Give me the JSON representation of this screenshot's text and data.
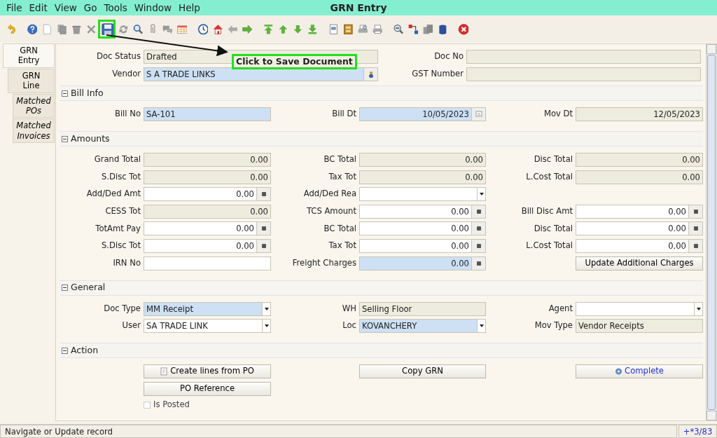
{
  "window": {
    "title": "GRN Entry"
  },
  "menu": [
    {
      "label": "File"
    },
    {
      "label": "Edit"
    },
    {
      "label": "View"
    },
    {
      "label": "Go"
    },
    {
      "label": "Tools"
    },
    {
      "label": "Window"
    },
    {
      "label": "Help"
    }
  ],
  "toolbar": [
    [
      {
        "kind": "undo",
        "highlighted": false
      }
    ],
    [
      {
        "kind": "help",
        "highlighted": false
      },
      {
        "kind": "new",
        "highlighted": false
      },
      {
        "kind": "copy",
        "highlighted": false
      },
      {
        "kind": "delete",
        "highlighted": false
      },
      {
        "kind": "delete-selection",
        "highlighted": false
      },
      {
        "kind": "save",
        "highlighted": true
      },
      {
        "kind": "refresh",
        "highlighted": false
      },
      {
        "kind": "find",
        "highlighted": false
      },
      {
        "kind": "attach",
        "highlighted": false
      },
      {
        "kind": "chat",
        "highlighted": false
      },
      {
        "kind": "grid",
        "highlighted": false
      }
    ],
    [
      {
        "kind": "history",
        "highlighted": false
      },
      {
        "kind": "home",
        "highlighted": false
      },
      {
        "kind": "previous",
        "highlighted": false
      },
      {
        "kind": "next",
        "highlighted": false
      }
    ],
    [
      {
        "kind": "first",
        "highlighted": false
      },
      {
        "kind": "up",
        "highlighted": false
      },
      {
        "kind": "down",
        "highlighted": false
      },
      {
        "kind": "last",
        "highlighted": false
      }
    ],
    [
      {
        "kind": "report",
        "highlighted": false
      },
      {
        "kind": "archive",
        "highlighted": false
      },
      {
        "kind": "print-preview",
        "highlighted": false
      },
      {
        "kind": "print",
        "highlighted": false
      }
    ],
    [
      {
        "kind": "zoom",
        "highlighted": false
      },
      {
        "kind": "move",
        "highlighted": false
      },
      {
        "kind": "product",
        "highlighted": false
      },
      {
        "kind": "workflow",
        "highlighted": false
      }
    ],
    [
      {
        "kind": "exit",
        "highlighted": false
      }
    ]
  ],
  "callout": {
    "text": "Click to Save Document"
  },
  "tabs": [
    {
      "label": "GRN Entry",
      "selected": true,
      "read_only": false,
      "children": [
        {
          "label": "GRN Line",
          "selected": false,
          "read_only": false,
          "children": [
            {
              "label": "Matched POs",
              "selected": false,
              "read_only": true
            },
            {
              "label": "Matched Invoices",
              "selected": false,
              "read_only": true
            }
          ]
        }
      ]
    }
  ],
  "header": [
    {
      "label": "Doc Status",
      "kind": "text",
      "read_only": true,
      "value": "Drafted"
    },
    {
      "label": "Doc No",
      "kind": "text",
      "read_only": true
    },
    {
      "label": "Vendor",
      "kind": "search",
      "value": "S A TRADE LINKS",
      "mandatory": true
    },
    {
      "label": "GST Number",
      "kind": "text",
      "read_only": true
    }
  ],
  "sections": [
    {
      "title": "Bill Info",
      "expanded": true,
      "rows": [
        [
          {
            "label": "Bill No",
            "kind": "text",
            "value": "SA-101",
            "mandatory": true
          },
          {
            "label": "Bill Dt",
            "kind": "date",
            "value": "10/05/2023",
            "mandatory": true
          },
          {
            "label": "Mov Dt",
            "kind": "date",
            "read_only": true,
            "value": "12/05/2023"
          }
        ]
      ]
    },
    {
      "title": "Amounts",
      "expanded": true,
      "rows": [
        [
          {
            "label": "Grand Total",
            "kind": "number",
            "read_only": true,
            "value": "0.00"
          },
          {
            "label": "BC Total",
            "kind": "number",
            "read_only": true,
            "value": "0.00"
          },
          {
            "label": "Disc Total",
            "kind": "number",
            "read_only": true,
            "value": "0.00"
          }
        ],
        [
          {
            "label": "S.Disc Tot",
            "kind": "number",
            "read_only": true,
            "value": "0.00"
          },
          {
            "label": "Tax Tot",
            "kind": "number",
            "read_only": true,
            "value": "0.00"
          },
          {
            "label": "L.Cost Total",
            "kind": "number",
            "read_only": true,
            "value": "0.00"
          }
        ],
        [
          {
            "label": "Add/Ded Amt",
            "kind": "number",
            "value": "0.00"
          },
          {
            "label": "Add/Ded Rea",
            "kind": "select"
          },
          null
        ],
        [
          {
            "label": "CESS Tot",
            "kind": "number",
            "read_only": true,
            "value": "0.00"
          },
          {
            "label": "TCS Amount",
            "kind": "number",
            "value": "0.00"
          },
          {
            "label": "Bill Disc Amt",
            "kind": "number",
            "value": "0.00"
          }
        ],
        [
          {
            "label": "TotAmt Pay",
            "kind": "number",
            "value": "0.00"
          },
          {
            "label": "BC Total",
            "kind": "number",
            "value": "0.00"
          },
          {
            "label": "Disc Total",
            "kind": "number",
            "value": "0.00"
          }
        ],
        [
          {
            "label": "S.Disc Tot",
            "kind": "number",
            "value": "0.00"
          },
          {
            "label": "Tax Tot",
            "kind": "number",
            "value": "0.00"
          },
          {
            "label": "L.Cost Total",
            "kind": "number",
            "value": "0.00"
          }
        ],
        [
          {
            "label": "IRN No",
            "kind": "text"
          },
          {
            "label": "Freight Charges",
            "kind": "number",
            "value": "0.00",
            "mandatory": true
          },
          {
            "kind": "button",
            "text": "Update Additional Charges",
            "highlighted": false
          }
        ]
      ]
    },
    {
      "title": "General",
      "expanded": true,
      "rows": [
        [
          {
            "label": "Doc Type",
            "kind": "select",
            "value": "MM Receipt",
            "mandatory": true
          },
          {
            "label": "WH",
            "kind": "text",
            "read_only": true,
            "value": "Selling Floor"
          },
          {
            "label": "Agent",
            "kind": "select"
          }
        ],
        [
          {
            "label": "User",
            "kind": "select",
            "value": "SA TRADE LINK"
          },
          {
            "label": "Loc",
            "kind": "select",
            "value": "KOVANCHERY",
            "mandatory": true
          },
          {
            "label": "Mov Type",
            "kind": "text",
            "read_only": true,
            "value": "Vendor Receipts"
          }
        ]
      ]
    },
    {
      "title": "Action",
      "expanded": true,
      "rows": [
        [
          {
            "kind": "process-button",
            "text": "Create lines from PO",
            "highlighted": false
          },
          {
            "kind": "button",
            "text": "Copy GRN",
            "highlighted": false
          },
          {
            "kind": "workflow-button",
            "text": "Complete",
            "highlighted": true
          }
        ],
        [
          {
            "kind": "button",
            "text": "PO Reference",
            "highlighted": false
          },
          null,
          null
        ],
        [
          {
            "kind": "checkbox",
            "text": "Is Posted",
            "checked": false,
            "disabled": true
          },
          null,
          null
        ]
      ]
    }
  ],
  "status_bar": {
    "message": "Navigate or Update record",
    "record": "+*3/83"
  }
}
